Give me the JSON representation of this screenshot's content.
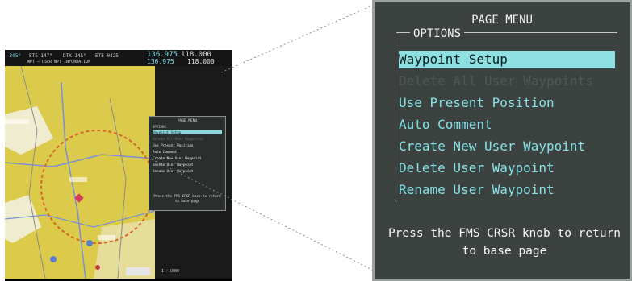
{
  "mfd": {
    "nav1": " 305°",
    "nav2": "ETE 147°",
    "nav3": "DTK 145°",
    "nav4": "ETE 0425",
    "com1_active": "136.975",
    "com1_standby": "118.000",
    "com2_active": "136.975",
    "com2_standby": "118.000",
    "page_title": "WPT – USER WPT INFORMATION",
    "map_scale": "1 ⁄ 5000",
    "mini_menu_title": "PAGE MENU",
    "mini_options_label": "OPTIONS",
    "mini_items": [
      "Waypoint Setup",
      "Delete All User Waypoints",
      "Use Present Position",
      "Auto Comment",
      "Create New User Waypoint",
      "Delete User Waypoint",
      "Rename User Waypoint"
    ],
    "mini_help": "Press the FMS CRSR knob to return to base page"
  },
  "menu": {
    "title": "PAGE MENU",
    "options_label": "OPTIONS",
    "items": [
      {
        "label": "Waypoint Setup",
        "state": "selected"
      },
      {
        "label": "Delete All User Waypoints",
        "state": "disabled"
      },
      {
        "label": "Use Present Position",
        "state": "enabled"
      },
      {
        "label": "Auto Comment",
        "state": "enabled"
      },
      {
        "label": "Create New User Waypoint",
        "state": "enabled"
      },
      {
        "label": "Delete User Waypoint",
        "state": "enabled"
      },
      {
        "label": "Rename User Waypoint",
        "state": "enabled"
      }
    ],
    "help_line1": "Press the FMS CRSR knob to return",
    "help_line2": "to base page"
  },
  "colors": {
    "menu_bg": "#3b4240",
    "item_text": "#86e1e6",
    "selected_bg": "#8fe0e3",
    "disabled_text": "#4f5857",
    "map_terrain": "#dccb4a"
  }
}
